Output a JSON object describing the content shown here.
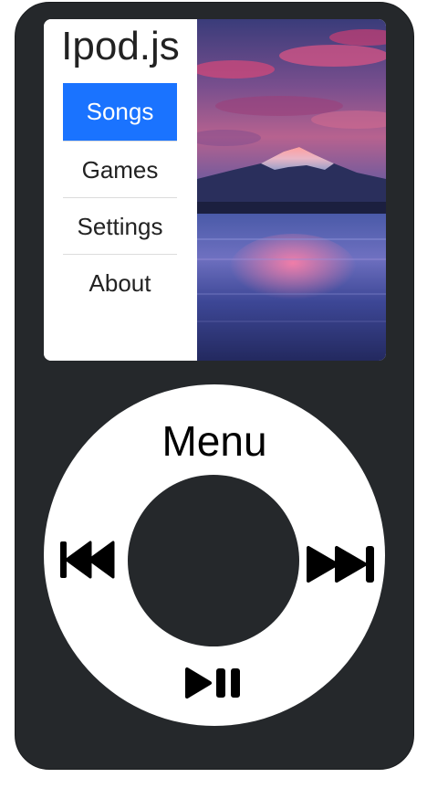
{
  "app": {
    "title": "Ipod.js"
  },
  "menu": {
    "items": [
      {
        "label": "Songs",
        "active": true
      },
      {
        "label": "Games",
        "active": false
      },
      {
        "label": "Settings",
        "active": false
      },
      {
        "label": "About",
        "active": false
      }
    ]
  },
  "wheel": {
    "menu_label": "Menu",
    "prev_icon": "skip-previous-icon",
    "next_icon": "skip-next-icon",
    "play_pause_icon": "play-pause-icon"
  },
  "colors": {
    "device_body": "#25282b",
    "active_item": "#1a73ff",
    "wheel": "#ffffff"
  },
  "wallpaper": {
    "subject": "mountain-lake-sunset"
  }
}
